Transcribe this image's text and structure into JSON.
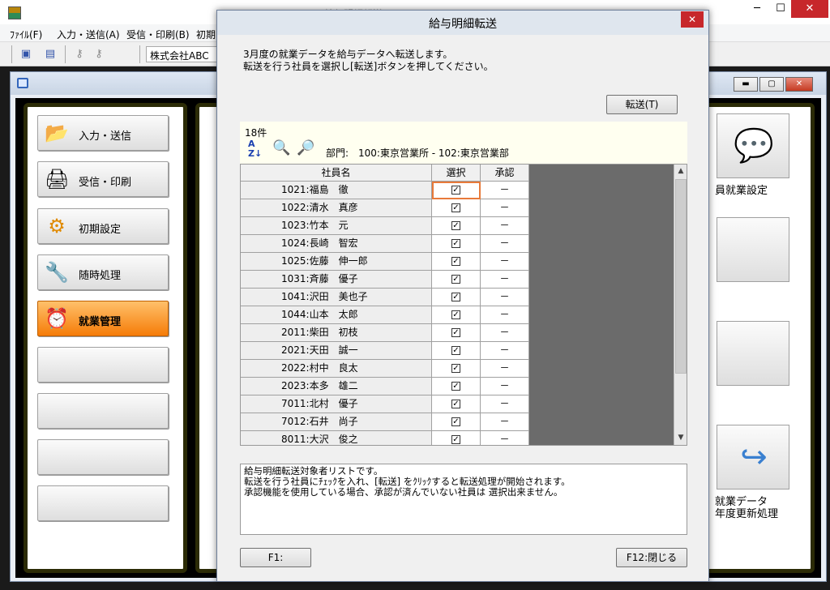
{
  "main": {
    "caption": "給与明細転送",
    "menu": [
      "ﾌｧｲﾙ(F)",
      "入力・送信(A)",
      "受信・印刷(B)",
      "初期"
    ],
    "company": "株式会社ABC"
  },
  "nav": [
    {
      "label": "入力・送信",
      "icon": "📂"
    },
    {
      "label": "受信・印刷",
      "icon": "🖨"
    },
    {
      "label": "初期設定",
      "icon": "⚙"
    },
    {
      "label": "随時処理",
      "icon": "🔧"
    },
    {
      "label": "就業管理",
      "icon": "⏰"
    }
  ],
  "right": {
    "employee_settings_label": "員就業設定",
    "year_update_line1": "就業データ",
    "year_update_line2": "年度更新処理"
  },
  "dialog": {
    "title": "給与明細転送",
    "close": "✕",
    "instruction1": "3月度の就業データを給与データへ転送します。",
    "instruction2": "転送を行う社員を選択し[転送]ボタンを押してください。",
    "transfer_button": "転送(T)",
    "record_count": "18件",
    "dept_label": "部門:",
    "dept_range": "100:東京営業所 - 102:東京営業部",
    "columns": {
      "name": "社員名",
      "select": "選択",
      "approve": "承認"
    },
    "rows": [
      {
        "name": "1021:福島　徹",
        "approve": "－"
      },
      {
        "name": "1022:清水　真彦",
        "approve": "－"
      },
      {
        "name": "1023:竹本　元",
        "approve": "－"
      },
      {
        "name": "1024:長崎　智宏",
        "approve": "－"
      },
      {
        "name": "1025:佐藤　伸一郎",
        "approve": "－"
      },
      {
        "name": "1031:斉藤　優子",
        "approve": "－"
      },
      {
        "name": "1041:沢田　美也子",
        "approve": "－"
      },
      {
        "name": "1044:山本　太郎",
        "approve": "－"
      },
      {
        "name": "2011:柴田　初枝",
        "approve": "－"
      },
      {
        "name": "2021:天田　誠一",
        "approve": "－"
      },
      {
        "name": "2022:村中　良太",
        "approve": "－"
      },
      {
        "name": "2023:本多　雄二",
        "approve": "－"
      },
      {
        "name": "7011:北村　優子",
        "approve": "－"
      },
      {
        "name": "7012:石井　尚子",
        "approve": "－"
      },
      {
        "name": "8011:大沢　俊之",
        "approve": "－"
      }
    ],
    "help1": "給与明細転送対象者リストです。",
    "help2": "転送を行う社員にﾁｪｯｸを入れ、[転送] をｸﾘｯｸすると転送処理が開始されます。",
    "help3": "承認機能を使用している場合、承認が済んでいない社員は 選択出来ません。",
    "f1_button": "F1:",
    "f12_button": "F12:閉じる"
  }
}
